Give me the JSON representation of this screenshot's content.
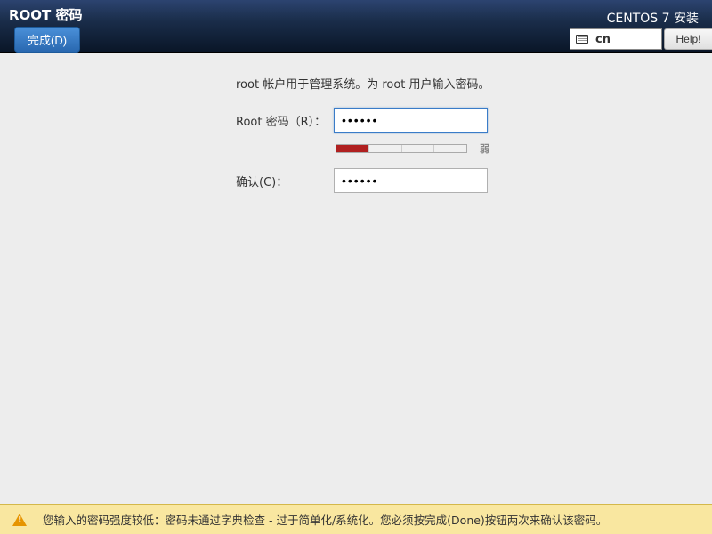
{
  "header": {
    "title": "ROOT 密码",
    "done_button": "完成(D)",
    "installer": "CENTOS 7 安装",
    "lang_code": "cn",
    "help_button": "Help!"
  },
  "form": {
    "instruction": "root 帐户用于管理系统。为 root 用户输入密码。",
    "root_password_label": "Root 密码（R）：",
    "root_password_value": "••••••",
    "confirm_label": "确认(C)：",
    "confirm_value": "••••••",
    "strength_label": "弱"
  },
  "warning": {
    "message": "您输入的密码强度较低：密码未通过字典检查 - 过于简单化/系统化。您必须按完成(Done)按钮两次来确认该密码。"
  }
}
